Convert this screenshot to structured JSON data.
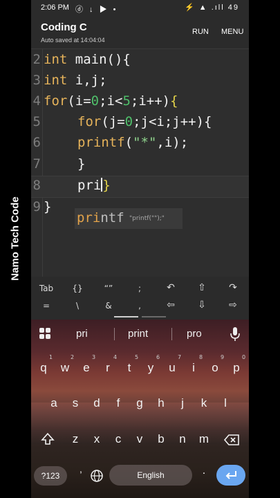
{
  "watermark": "Namo Tech Code",
  "status": {
    "time": "2:06 PM",
    "icons_left": "ⓓ ↓ ▶ •",
    "right": "⚡ ▲ .ıll 49"
  },
  "appbar": {
    "title": "Coding C",
    "subtitle": "Auto saved at 14:04:04",
    "run": "RUN",
    "menu": "MENU"
  },
  "editor": {
    "line_numbers": [
      "2",
      "3",
      "4",
      "5",
      "6",
      "7",
      "8",
      "9"
    ],
    "lines": [
      {
        "a": "int",
        "b": " main(){"
      },
      {
        "a": "int",
        "b": " i,j;"
      },
      {
        "a": "for",
        "b": "(i=",
        "n1": "0",
        "c": ";i<",
        "n2": "5",
        "d": ";i++)",
        "e": "{"
      },
      {
        "a": "for",
        "b": "(j=",
        "n1": "0",
        "c": ";j<i;j++){"
      },
      {
        "a": "printf",
        "b": "(",
        "s": "\"*\"",
        "c": ",i);"
      },
      {
        "a": "}"
      },
      {
        "a": "pri",
        "e": "}"
      },
      {
        "a": "}"
      }
    ],
    "suggestion": {
      "match": "pri",
      "rest": "ntf",
      "hint": "\"printf(\"\");\""
    }
  },
  "symbols": {
    "row1": [
      "Tab",
      "{}",
      "“”",
      ";",
      "↶",
      "⇧",
      "↷"
    ],
    "row2": [
      "=",
      "\\",
      "&",
      ",",
      "⇦",
      "⇩",
      "⇨"
    ]
  },
  "keyboard": {
    "suggestions": [
      "pri",
      "print",
      "pro"
    ],
    "row1": [
      "q",
      "w",
      "e",
      "r",
      "t",
      "y",
      "u",
      "i",
      "o",
      "p"
    ],
    "row1_sup": [
      "1",
      "2",
      "3",
      "4",
      "5",
      "6",
      "7",
      "8",
      "9",
      "0"
    ],
    "row2": [
      "a",
      "s",
      "d",
      "f",
      "g",
      "h",
      "j",
      "k",
      "l"
    ],
    "row3": [
      "z",
      "x",
      "c",
      "v",
      "b",
      "n",
      "m"
    ],
    "num_key": "?123",
    "comma": ",",
    "space": "English",
    "period": "."
  },
  "colors": {
    "keyword": "#e6b35a",
    "number": "#4fbf6a",
    "brace": "#e3d34a",
    "enter": "#6aa6f0"
  }
}
